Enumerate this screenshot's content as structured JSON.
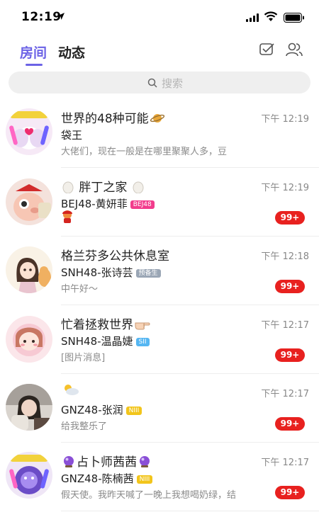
{
  "status_bar": {
    "time": "12:19"
  },
  "tabs": {
    "rooms": "房间",
    "feed": "动态"
  },
  "search": {
    "placeholder": "搜索"
  },
  "rooms": [
    {
      "title": "世界的48种可能",
      "sender": "袋王",
      "preview": "大佬们，现在一般是在哪里聚聚人多，豆",
      "time": "下午 12:19",
      "count": "",
      "badge": "",
      "badge_color": ""
    },
    {
      "title": "胖丁之家",
      "sender": "BEJ48-黄妍菲",
      "preview": "",
      "time": "下午 12:19",
      "count": "99+",
      "badge": "BEJ48",
      "badge_color": "#f23c8c"
    },
    {
      "title": "格兰芬多公共休息室",
      "sender": "SNH48-张诗芸",
      "preview": "中午好～",
      "time": "下午 12:18",
      "count": "99+",
      "badge": "预备生",
      "badge_color": "#9aa6b5"
    },
    {
      "title": "忙着拯救世界",
      "sender": "SNH48-温晶婕",
      "preview": "[图片消息]",
      "time": "下午 12:17",
      "count": "99+",
      "badge": "SII",
      "badge_color": "#55b6f2"
    },
    {
      "title": "",
      "sender": "GNZ48-张润",
      "preview": "给我整乐了",
      "time": "下午 12:17",
      "count": "99+",
      "badge": "NIII",
      "badge_color": "#f2c51b"
    },
    {
      "title": "占卜师茜茜",
      "sender": "GNZ48-陈楠茜",
      "preview": "假天使。我昨天喊了一晚上我想喝奶绿，结",
      "time": "下午 12:17",
      "count": "99+",
      "badge": "NIII",
      "badge_color": "#f2c51b"
    }
  ]
}
